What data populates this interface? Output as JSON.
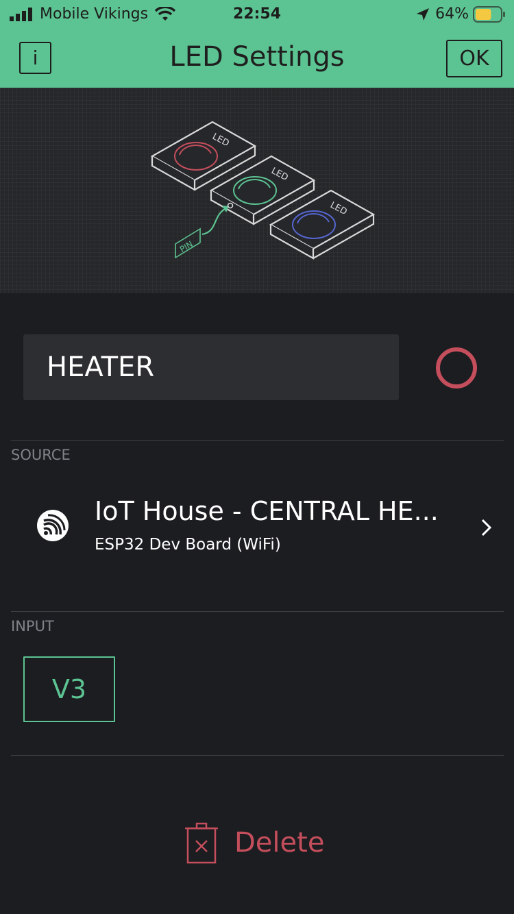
{
  "status_bar": {
    "carrier": "Mobile Vikings",
    "time": "22:54",
    "battery_percent": "64%",
    "battery_level": 0.64,
    "icons": [
      "signal-icon",
      "wifi-icon",
      "location-arrow-icon",
      "battery-icon"
    ]
  },
  "header": {
    "title": "LED Settings",
    "info_label": "i",
    "ok_label": "OK"
  },
  "illustration": {
    "led_label": "LED",
    "pin_label": "PIN",
    "led_colors": [
      "#c44e5c",
      "#5cc492",
      "#5566d0"
    ]
  },
  "widget": {
    "name_value": "HEATER",
    "color": "#c44e5c"
  },
  "source": {
    "section_label": "SOURCE",
    "device_name": "IoT House - CENTRAL HE...",
    "device_type": "ESP32 Dev Board (WiFi)",
    "icon": "espressif-icon"
  },
  "input": {
    "section_label": "INPUT",
    "pin_value": "V3"
  },
  "actions": {
    "delete_label": "Delete"
  },
  "colors": {
    "accent_green": "#5cc492",
    "danger_red": "#c44e5c",
    "background": "#1c1d21"
  }
}
